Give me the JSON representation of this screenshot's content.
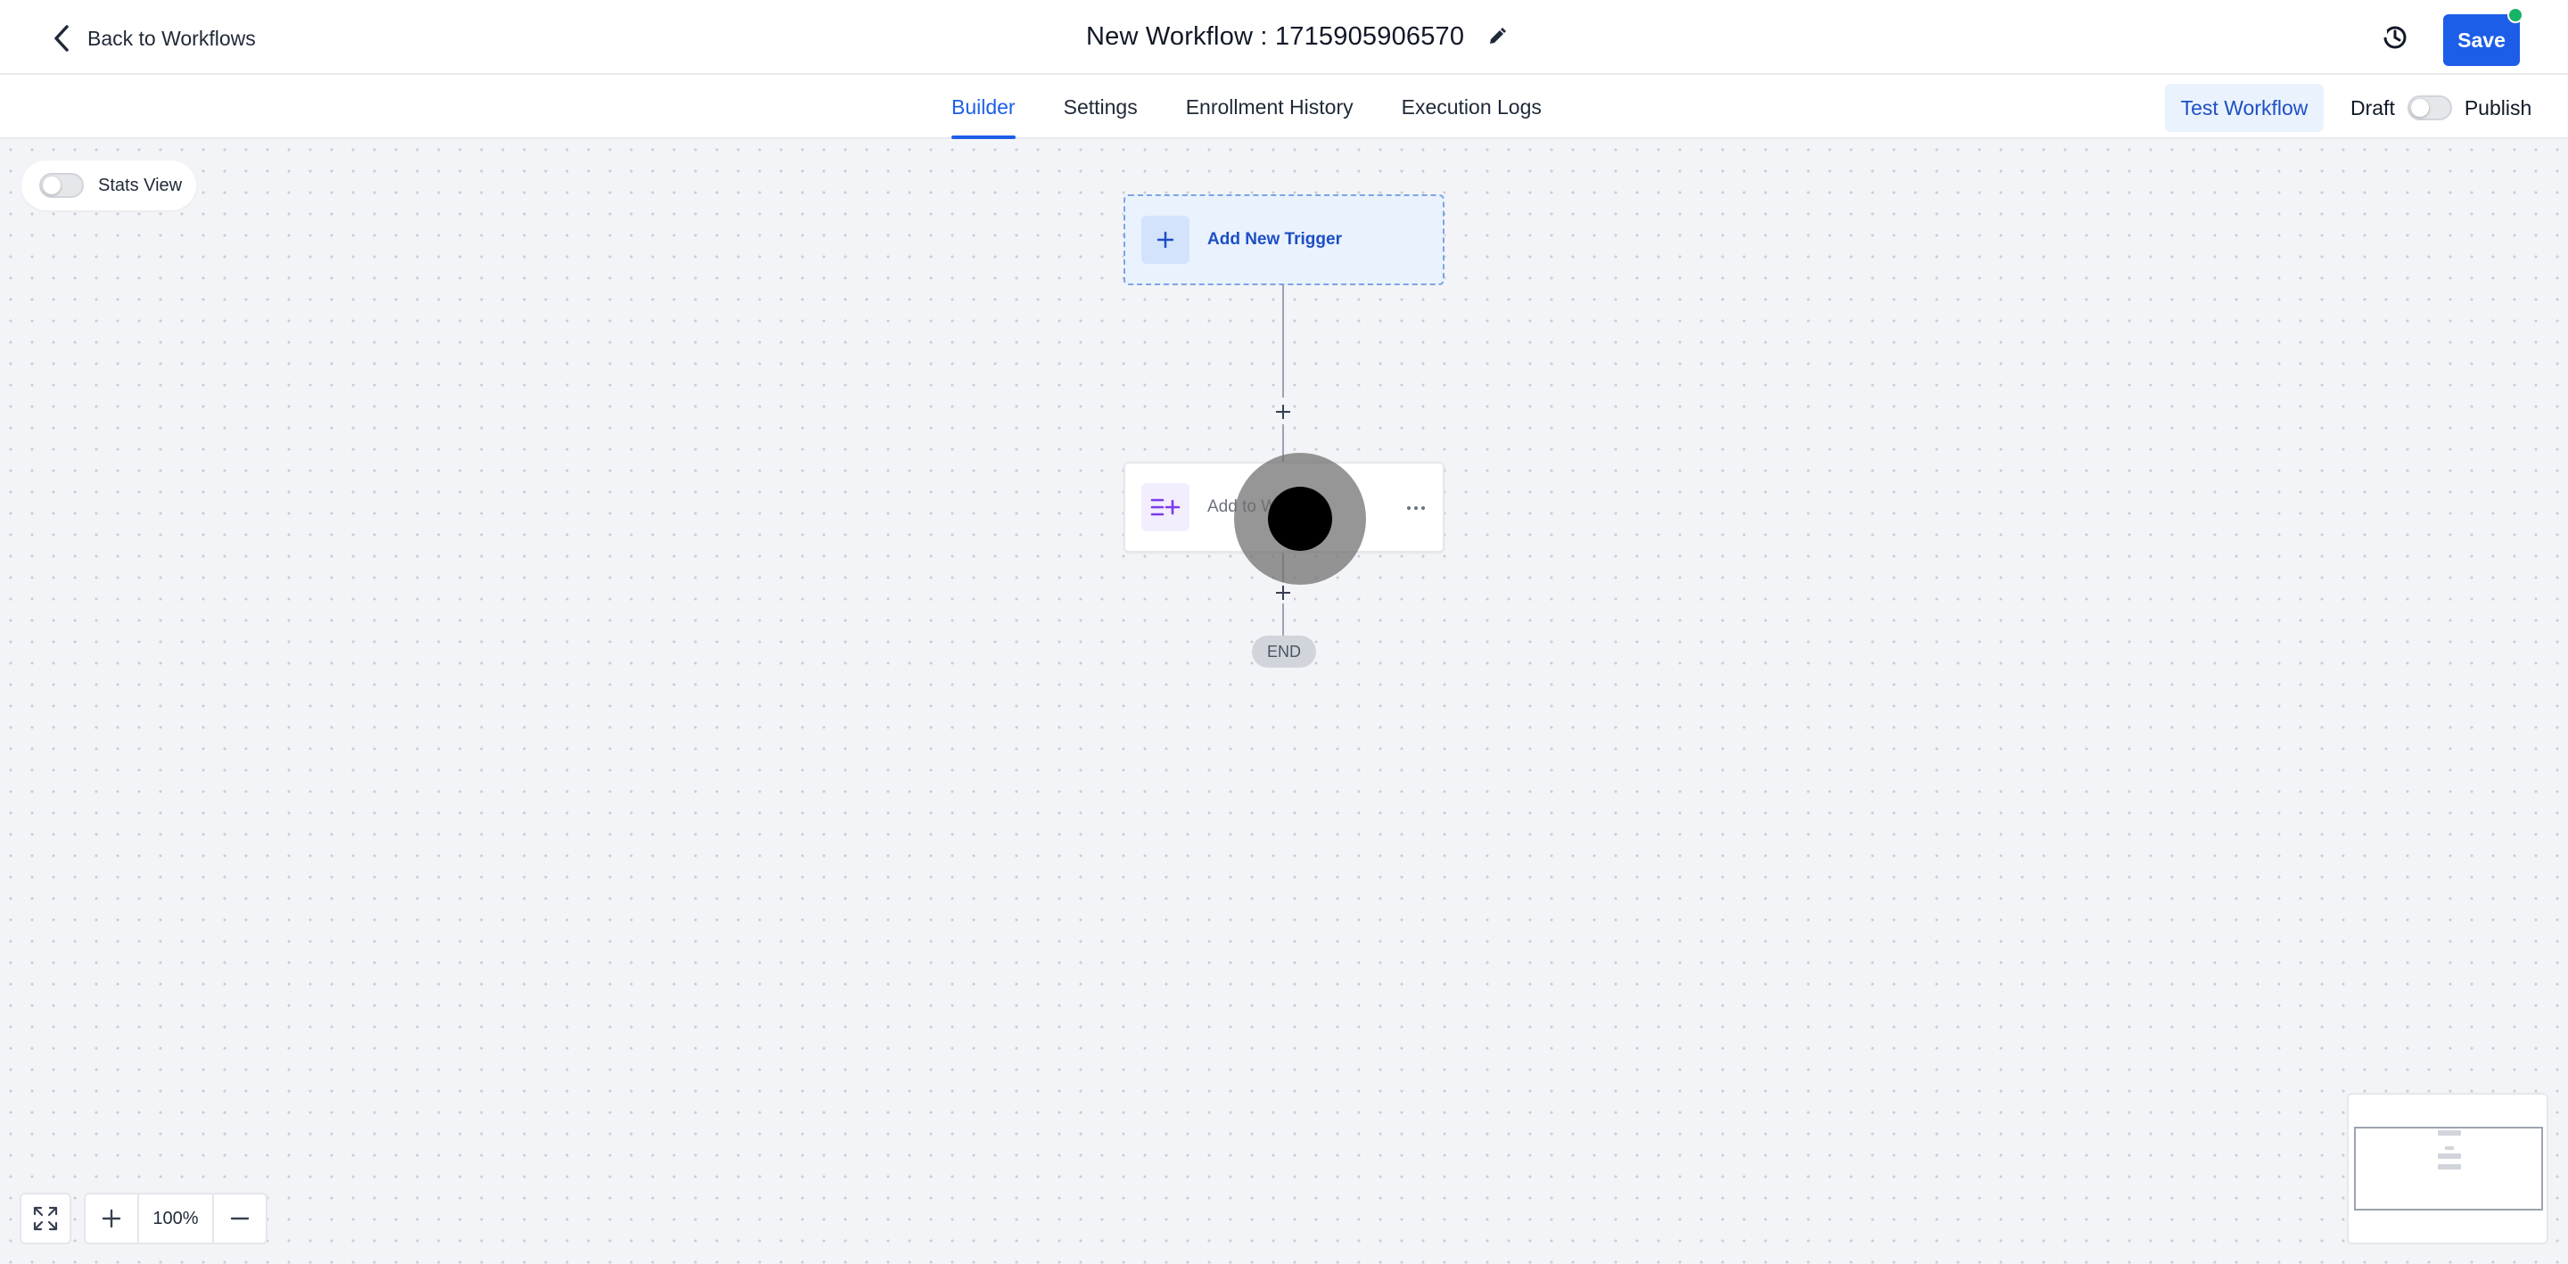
{
  "header": {
    "back_label": "Back to Workflows",
    "title": "New Workflow : 1715905906570",
    "save_label": "Save"
  },
  "tabs": [
    {
      "label": "Builder",
      "active": true
    },
    {
      "label": "Settings",
      "active": false
    },
    {
      "label": "Enrollment History",
      "active": false
    },
    {
      "label": "Execution Logs",
      "active": false
    }
  ],
  "toolbar": {
    "test_label": "Test Workflow",
    "draft_label": "Draft",
    "publish_label": "Publish"
  },
  "canvas": {
    "stats_label": "Stats View",
    "trigger_label": "Add New Trigger",
    "action_label": "Add to Wo",
    "end_label": "END"
  },
  "zoom": {
    "level": "100%"
  },
  "colors": {
    "primary": "#1d5ee8",
    "status_dot": "#16b364",
    "action_icon": "#7c3aed"
  }
}
